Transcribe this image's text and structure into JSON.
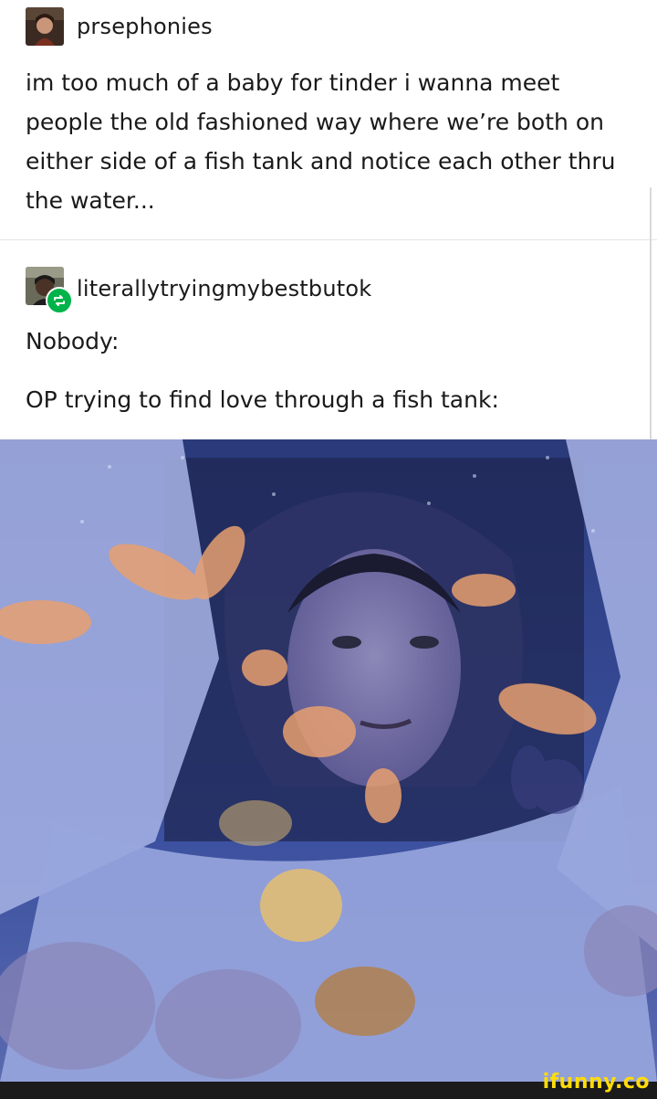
{
  "post1": {
    "username": "prsephonies",
    "text": "im too much of a baby for tinder i wanna meet people the old fashioned way where we’re both on either side of a fish tank and notice each other thru the water..."
  },
  "post2": {
    "username": "literallytryingmybestbutok",
    "line1": "Nobody:",
    "line2": "OP trying to find love through a fish tank:"
  },
  "image": {
    "alt_icon": "man-behind-fish-tank-photo"
  },
  "footer": {
    "watermark": "ifunny.co"
  },
  "colors": {
    "reblog_green": "#00b34a",
    "watermark_yellow": "#ffdc0a"
  }
}
